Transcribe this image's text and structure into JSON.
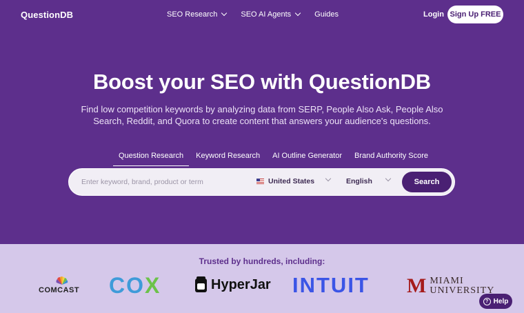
{
  "header": {
    "logo": "QuestionDB",
    "nav": [
      {
        "label": "SEO Research"
      },
      {
        "label": "SEO AI Agents"
      },
      {
        "label": "Guides"
      }
    ],
    "login": "Login",
    "signup": "Sign Up FREE"
  },
  "hero": {
    "title": "Boost your SEO with QuestionDB",
    "subtitle": "Find low competition keywords by analyzing data from SERP, People Also Ask, People Also Search, Reddit, and Quora to create content that answers your audience's questions."
  },
  "tabs": [
    {
      "label": "Question Research",
      "active": true
    },
    {
      "label": "Keyword Research"
    },
    {
      "label": "AI Outline Generator"
    },
    {
      "label": "Brand Authority Score"
    }
  ],
  "search": {
    "placeholder": "Enter keyword, brand, product or term",
    "country": "United States",
    "language": "English",
    "button": "Search"
  },
  "trusted": {
    "label": "Trusted by hundreds, including:",
    "brands": {
      "comcast": "COMCAST",
      "cox_co": "CO",
      "cox_x": "X",
      "hyperjar": "HyperJar",
      "intuit": "INTUIT",
      "miami_m": "M",
      "miami_line1": "MIAMI",
      "miami_line2": "UNIVERSITY"
    }
  },
  "help": "Help",
  "colors": {
    "hero_bg": "#5d2f8c",
    "trusted_bg": "#d5c8ea",
    "button_bg": "#4a2073"
  }
}
